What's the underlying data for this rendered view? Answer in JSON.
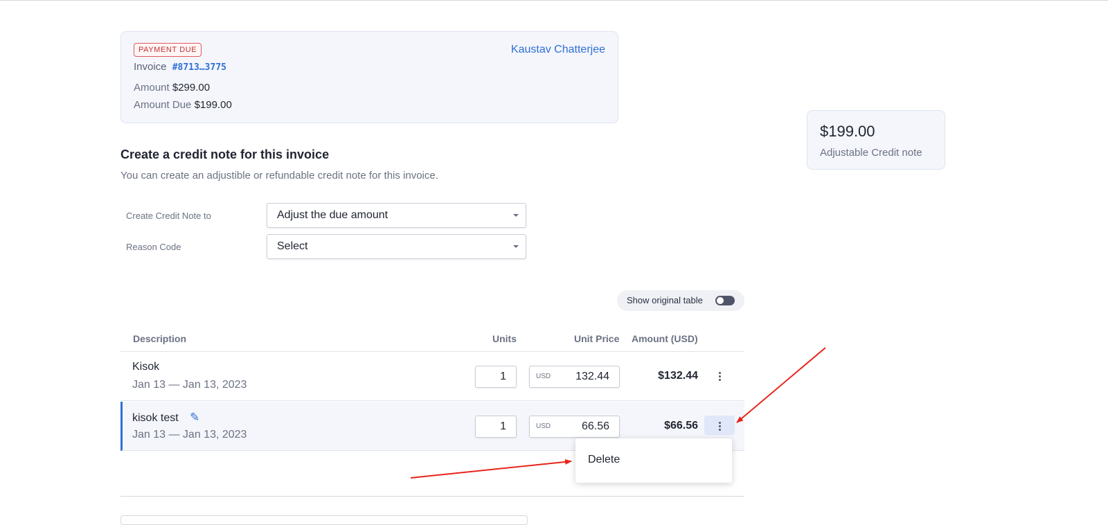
{
  "invoice": {
    "status_badge": "PAYMENT DUE",
    "label": "Invoice",
    "number": "#8713…3775",
    "customer_name": "Kaustav Chatterjee",
    "amount_label": "Amount",
    "amount_value": "$299.00",
    "amount_due_label": "Amount Due",
    "amount_due_value": "$199.00"
  },
  "credit_note": {
    "title": "Create a credit note for this invoice",
    "subtitle": "You can create an adjustible or refundable credit note for this invoice.",
    "create_to_label": "Create Credit Note to",
    "create_to_value": "Adjust the due amount",
    "reason_label": "Reason Code",
    "reason_value": "Select"
  },
  "summary": {
    "amount": "$199.00",
    "label": "Adjustable Credit note"
  },
  "toggle": {
    "label": "Show original table",
    "enabled": false
  },
  "table": {
    "headers": {
      "description": "Description",
      "units": "Units",
      "unit_price": "Unit Price",
      "amount": "Amount (USD)"
    },
    "rows": [
      {
        "title": "Kisok",
        "date_range": "Jan 13 — Jan 13, 2023",
        "units": "1",
        "currency": "USD",
        "unit_price": "132.44",
        "amount": "$132.44"
      },
      {
        "title": "kisok test",
        "date_range": "Jan 13 — Jan 13, 2023",
        "units": "1",
        "currency": "USD",
        "unit_price": "66.56",
        "amount": "$66.56"
      }
    ]
  },
  "row_menu": {
    "delete_label": "Delete"
  },
  "colors": {
    "accent": "#2f6fd6",
    "badge_red": "#c62f33",
    "annotation_arrow": "#e8231a"
  },
  "icons": {
    "edit": "pencil-icon",
    "row_actions": "kebab-menu-icon",
    "select_caret": "caret-down-icon"
  }
}
